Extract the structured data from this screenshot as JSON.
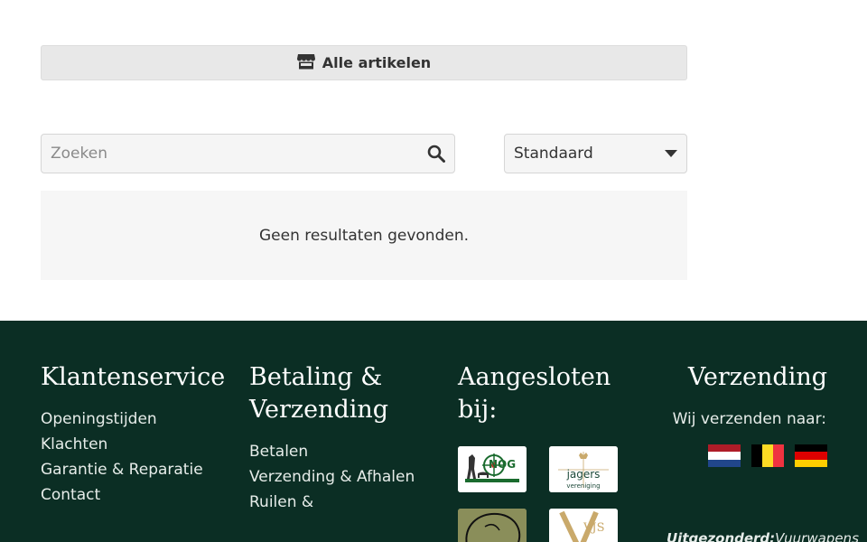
{
  "main": {
    "all_button_label": "Alle artikelen",
    "search_placeholder": "Zoeken",
    "sort_selected": "Standaard",
    "no_results": "Geen resultaten gevonden."
  },
  "footer": {
    "customer_service": {
      "title": "Klantenservice",
      "links": [
        "Openingstijden",
        "Klachten",
        "Garantie & Reparatie",
        "Contact"
      ]
    },
    "payment": {
      "title": "Betaling & Verzending",
      "links": [
        "Betalen",
        "Verzending & Afhalen",
        "Ruilen &"
      ]
    },
    "affiliated": {
      "title": "Aangesloten bij:",
      "logos": [
        {
          "name": "nog-logo",
          "text": "NOG"
        },
        {
          "name": "jagersvereniging-logo",
          "text": "jagers",
          "subtext": "vereniging"
        },
        {
          "name": "hunter-badge-logo"
        },
        {
          "name": "vjs-logo",
          "text": "VJS"
        }
      ]
    },
    "shipping": {
      "title": "Verzending",
      "text": "Wij verzenden naar:",
      "flags": [
        "netherlands-flag",
        "belgium-flag",
        "germany-flag"
      ],
      "except_label": "Uitgezonderd:",
      "except_text": "Vuurwapens"
    }
  },
  "colors": {
    "footer_bg": "#0b2e24",
    "button_bg": "#e8e8e8",
    "text": "#333333"
  }
}
